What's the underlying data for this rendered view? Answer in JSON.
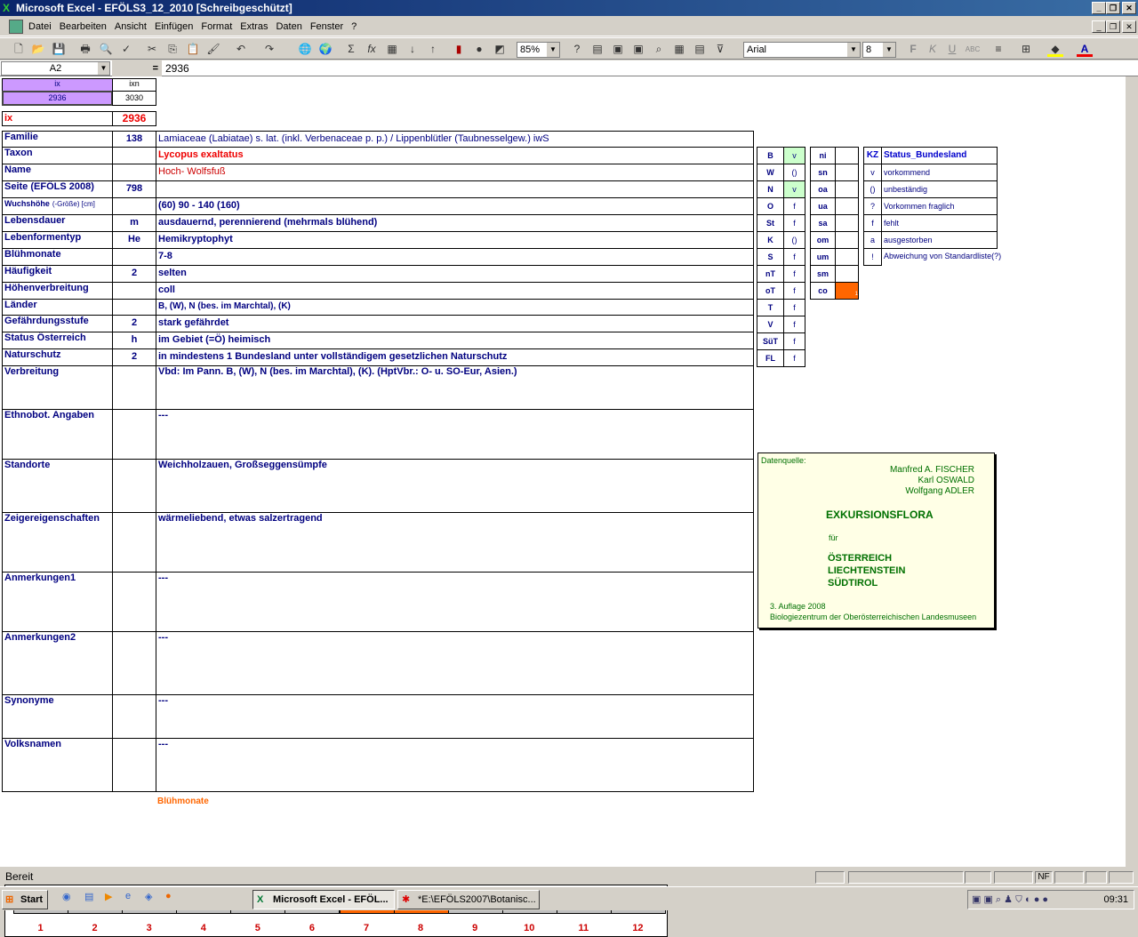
{
  "window": {
    "title": "Microsoft Excel - EFÖLS3_12_2010  [Schreibgeschützt]"
  },
  "menu": [
    "Datei",
    "Bearbeiten",
    "Ansicht",
    "Einfügen",
    "Format",
    "Extras",
    "Daten",
    "Fenster",
    "?"
  ],
  "toolbar": {
    "zoom": "85%",
    "font": "Arial",
    "font_size": "8"
  },
  "formula_bar": {
    "name_box": "A2",
    "equals": "=",
    "value": "2936"
  },
  "index": {
    "ix_header": "ix",
    "ixn_header": "ixn",
    "ix_value": "2936",
    "ixn_value": "3030",
    "ix_label": "ix",
    "ix_display": "2936"
  },
  "rows": [
    {
      "label": "Familie",
      "code": "138",
      "value": "Lamiaceae (Labiatae) s. lat. (inkl. Verbenaceae p. p.)  /  Lippenblütler (Taubnesselgew.) iwS"
    },
    {
      "label": "Taxon",
      "code": "",
      "value": "Lycopus exaltatus"
    },
    {
      "label": "Name",
      "code": "",
      "value": "Hoch- Wolfsfuß"
    },
    {
      "label": "Seite (EFÖLS 2008)",
      "code": "798",
      "value": ""
    },
    {
      "label": "Wuchshöhe",
      "label_suffix": "(-Größe) [cm]",
      "code": "",
      "value": " (60) 90 - 140 (160)"
    },
    {
      "label": "Lebensdauer",
      "code": "m",
      "value": "ausdauernd, perennierend (mehrmals blühend)"
    },
    {
      "label": "Lebenformentyp",
      "code": "He",
      "value": "Hemikryptophyt"
    },
    {
      "label": "Blühmonate",
      "code": "",
      "value": " 7-8"
    },
    {
      "label": "Häufigkeit",
      "code": "2",
      "value": "selten"
    },
    {
      "label": "Höhenverbreitung",
      "code": "",
      "value": "coll"
    },
    {
      "label": "Länder",
      "code": "",
      "value": "B, (W), N (bes. im Marchtal), (K)"
    },
    {
      "label": "Gefährdungsstufe",
      "code": "2",
      "value": "stark gefährdet"
    },
    {
      "label": "Status Österreich",
      "code": "h",
      "value": "im Gebiet (=Ö) heimisch"
    },
    {
      "label": "Naturschutz",
      "code": "2",
      "value": "in mindestens 1 Bundesland unter vollständigem gesetzlichen Naturschutz"
    },
    {
      "label": "Verbreitung",
      "code": "",
      "value": "Vbd: Im Pann. B, (W), N (bes. im Marchtal), (K). (HptVbr.: O- u. SO-Eur, Asien.)"
    },
    {
      "label": "Ethnobot. Angaben",
      "code": "",
      "value": "---"
    },
    {
      "label": "Standorte",
      "code": "",
      "value": "Weichholzauen, Großseggensümpfe"
    },
    {
      "label": "Zeigereigenschaften",
      "code": "",
      "value": " wärmeliebend, etwas salzertragend"
    },
    {
      "label": "Anmerkungen1",
      "code": "",
      "value": "---"
    },
    {
      "label": "Anmerkungen2",
      "code": "",
      "value": "---"
    },
    {
      "label": "Synonyme",
      "code": "",
      "value": "---"
    },
    {
      "label": "Volksnamen",
      "code": "",
      "value": "---"
    }
  ],
  "bundeslaender": [
    {
      "code": "B",
      "status": "v",
      "highlight": true
    },
    {
      "code": "W",
      "status": "()"
    },
    {
      "code": "N",
      "status": "v",
      "highlight": true
    },
    {
      "code": "O",
      "status": "f"
    },
    {
      "code": "St",
      "status": "f"
    },
    {
      "code": "K",
      "status": "()"
    },
    {
      "code": "S",
      "status": "f"
    },
    {
      "code": "nT",
      "status": "f"
    },
    {
      "code": "oT",
      "status": "f"
    },
    {
      "code": "T",
      "status": "f"
    },
    {
      "code": "V",
      "status": "f"
    },
    {
      "code": "SüT",
      "status": "f"
    },
    {
      "code": "FL",
      "status": "f"
    }
  ],
  "hoehenstufen": [
    {
      "code": "ni",
      "value": ""
    },
    {
      "code": "sn",
      "value": ""
    },
    {
      "code": "oa",
      "value": ""
    },
    {
      "code": "ua",
      "value": ""
    },
    {
      "code": "sa",
      "value": ""
    },
    {
      "code": "om",
      "value": ""
    },
    {
      "code": "um",
      "value": ""
    },
    {
      "code": "sm",
      "value": ""
    },
    {
      "code": "co",
      "value": "1",
      "highlight": true
    }
  ],
  "legend": {
    "header_kz": "KZ",
    "header_status": "Status_Bundesland",
    "items": [
      {
        "kz": "v",
        "text": "vorkommend"
      },
      {
        "kz": "()",
        "text": "unbeständig"
      },
      {
        "kz": "?",
        "text": "Vorkommen fraglich"
      },
      {
        "kz": "f",
        "text": "fehlt"
      },
      {
        "kz": "a",
        "text": "ausgestorben"
      },
      {
        "kz": "!",
        "text": "Abweichung von Standardliste(?)"
      }
    ]
  },
  "source": {
    "label": "Datenquelle:",
    "author1": "Manfred A. FISCHER",
    "author2": "Karl OSWALD",
    "author3": "Wolfgang ADLER",
    "title": "EXKURSIONSFLORA",
    "fuer": "für",
    "region1": "ÖSTERREICH",
    "region2": "LIECHTENSTEIN",
    "region3": "SÜDTIROL",
    "edition": "3. Auflage 2008",
    "publisher": "Biologiezentrum der Oberösterreichischen Landesmuseen"
  },
  "bloom_chart": {
    "title": "Blühmonate",
    "months": [
      "1",
      "2",
      "3",
      "4",
      "5",
      "6",
      "7",
      "8",
      "9",
      "10",
      "11",
      "12"
    ],
    "flowering": [
      7,
      8
    ],
    "colors": {
      "on": "#ff6600",
      "off": "#c0c0c0",
      "labels": "#cc0000"
    }
  },
  "status": {
    "text": "Bereit",
    "nf": "NF"
  },
  "taskbar": {
    "start": "Start",
    "tasks": [
      "Microsoft Excel - EFÖL...",
      "*E:\\EFÖLS2007\\Botanisc..."
    ],
    "clock": "09:31"
  }
}
